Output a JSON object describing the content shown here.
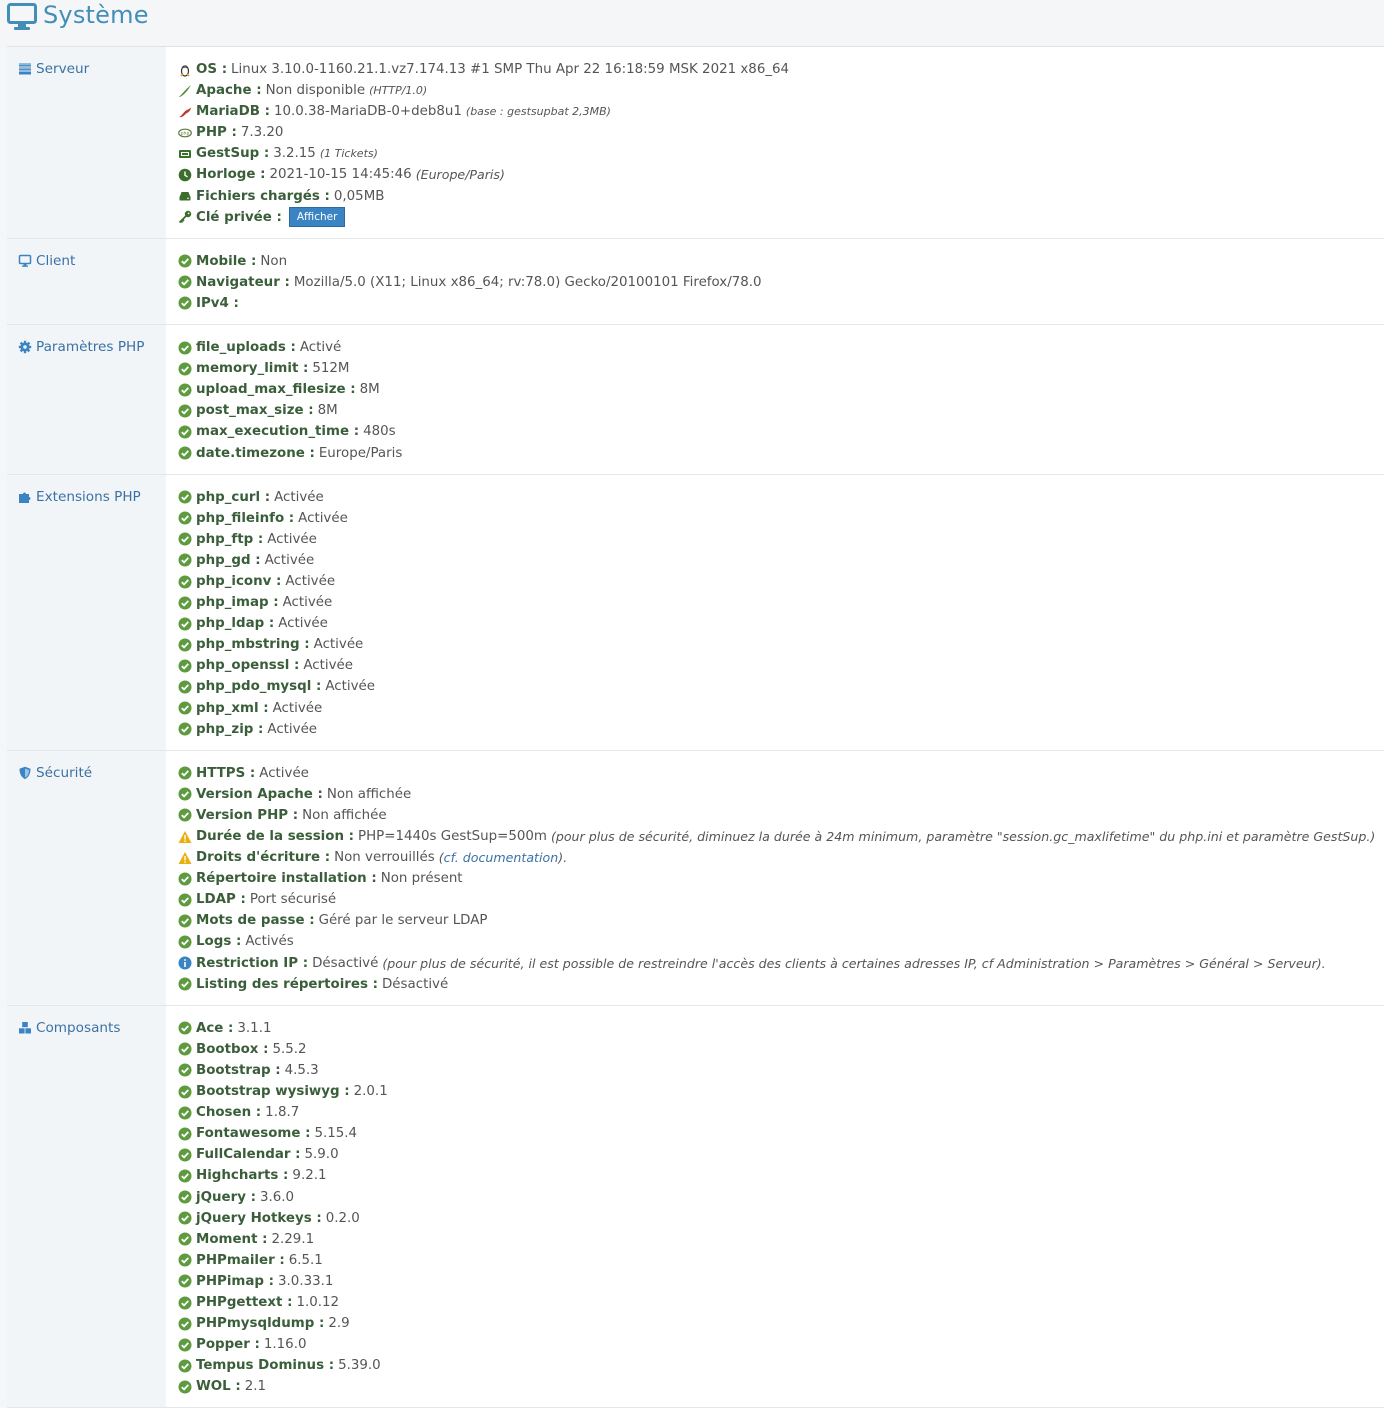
{
  "header": {
    "title": "Système"
  },
  "sections": {
    "serveur": {
      "label": "Serveur",
      "rows": [
        {
          "key": "OS :",
          "value": "Linux 3.10.0-1160.21.1.vz7.174.13 #1 SMP Thu Apr 22 16:18:59 MSK 2021 x86_64",
          "icon": "linux-icon"
        },
        {
          "key": "Apache :",
          "value": "Non disponible",
          "note": "(HTTP/1.0)",
          "icon": "apache-feather-icon"
        },
        {
          "key": "MariaDB :",
          "value": "10.0.38-MariaDB-0+deb8u1",
          "note": "(base : gestsupbat 2,3MB)",
          "icon": "mariadb-seal-icon"
        },
        {
          "key": "PHP :",
          "value": "7.3.20",
          "icon": "php-icon"
        },
        {
          "key": "GestSup :",
          "value": "3.2.15",
          "note": "(1 Tickets)",
          "icon": "ticket-icon"
        },
        {
          "key": "Horloge :",
          "value": "2021-10-15 14:45:46",
          "note": "(Europe/Paris)",
          "icon": "clock-icon"
        },
        {
          "key": "Fichiers chargés :",
          "value": "0,05MB",
          "icon": "hdd-icon"
        },
        {
          "key": "Clé privée :",
          "button": "Afficher",
          "icon": "key-icon"
        }
      ]
    },
    "client": {
      "label": "Client",
      "rows": [
        {
          "key": "Mobile :",
          "value": "Non"
        },
        {
          "key": "Navigateur :",
          "value": "Mozilla/5.0 (X11; Linux x86_64; rv:78.0) Gecko/20100101 Firefox/78.0"
        },
        {
          "key": "IPv4 :",
          "value": ""
        }
      ]
    },
    "php_params": {
      "label": "Paramètres PHP",
      "rows": [
        {
          "key": "file_uploads :",
          "value": "Activé"
        },
        {
          "key": "memory_limit :",
          "value": "512M"
        },
        {
          "key": "upload_max_filesize :",
          "value": "8M"
        },
        {
          "key": "post_max_size :",
          "value": "8M"
        },
        {
          "key": "max_execution_time :",
          "value": "480s"
        },
        {
          "key": "date.timezone :",
          "value": "Europe/Paris"
        }
      ]
    },
    "php_ext": {
      "label": "Extensions PHP",
      "rows": [
        {
          "key": "php_curl :",
          "value": "Activée"
        },
        {
          "key": "php_fileinfo :",
          "value": "Activée"
        },
        {
          "key": "php_ftp :",
          "value": "Activée"
        },
        {
          "key": "php_gd :",
          "value": "Activée"
        },
        {
          "key": "php_iconv :",
          "value": "Activée"
        },
        {
          "key": "php_imap :",
          "value": "Activée"
        },
        {
          "key": "php_ldap :",
          "value": "Activée"
        },
        {
          "key": "php_mbstring :",
          "value": "Activée"
        },
        {
          "key": "php_openssl :",
          "value": "Activée"
        },
        {
          "key": "php_pdo_mysql :",
          "value": "Activée"
        },
        {
          "key": "php_xml :",
          "value": "Activée"
        },
        {
          "key": "php_zip :",
          "value": "Activée"
        }
      ]
    },
    "securite": {
      "label": "Sécurité",
      "rows": [
        {
          "key": "HTTPS :",
          "value": "Activée",
          "status": "ok"
        },
        {
          "key": "Version Apache :",
          "value": "Non affichée",
          "status": "ok"
        },
        {
          "key": "Version PHP :",
          "value": "Non affichée",
          "status": "ok"
        },
        {
          "key": "Durée de la session :",
          "value": "PHP=1440s GestSup=500m",
          "note": "(pour plus de sécurité, diminuez la durée à 24m minimum, paramètre \"session.gc_maxlifetime\" du php.ini et paramètre GestSup.)",
          "status": "warn"
        },
        {
          "key": "Droits d'écriture :",
          "value": "Non verrouillés",
          "note_link": "cf. documentation",
          "status": "warn"
        },
        {
          "key": "Répertoire installation :",
          "value": "Non présent",
          "status": "ok"
        },
        {
          "key": "LDAP :",
          "value": "Port sécurisé",
          "status": "ok"
        },
        {
          "key": "Mots de passe :",
          "value": "Géré par le serveur LDAP",
          "status": "ok"
        },
        {
          "key": "Logs :",
          "value": "Activés",
          "status": "ok"
        },
        {
          "key": "Restriction IP :",
          "value": "Désactivé",
          "note": "(pour plus de sécurité, il est possible de restreindre l'accès des clients à certaines adresses IP, cf Administration > Paramètres > Général > Serveur).",
          "status": "info"
        },
        {
          "key": "Listing des répertoires :",
          "value": "Désactivé",
          "status": "ok"
        }
      ]
    },
    "composants": {
      "label": "Composants",
      "rows": [
        {
          "key": "Ace :",
          "value": "3.1.1"
        },
        {
          "key": "Bootbox :",
          "value": "5.5.2"
        },
        {
          "key": "Bootstrap :",
          "value": "4.5.3"
        },
        {
          "key": "Bootstrap wysiwyg :",
          "value": "2.0.1"
        },
        {
          "key": "Chosen :",
          "value": "1.8.7"
        },
        {
          "key": "Fontawesome :",
          "value": "5.15.4"
        },
        {
          "key": "FullCalendar :",
          "value": "5.9.0"
        },
        {
          "key": "Highcharts :",
          "value": "9.2.1"
        },
        {
          "key": "jQuery :",
          "value": "3.6.0"
        },
        {
          "key": "jQuery Hotkeys :",
          "value": "0.2.0"
        },
        {
          "key": "Moment :",
          "value": "2.29.1"
        },
        {
          "key": "PHPmailer :",
          "value": "6.5.1"
        },
        {
          "key": "PHPimap :",
          "value": "3.0.33.1"
        },
        {
          "key": "PHPgettext :",
          "value": "1.0.12"
        },
        {
          "key": "PHPmysqldump :",
          "value": "2.9"
        },
        {
          "key": "Popper :",
          "value": "1.16.0"
        },
        {
          "key": "Tempus Dominus :",
          "value": "5.39.0"
        },
        {
          "key": "WOL :",
          "value": "2.1"
        }
      ]
    }
  },
  "colors": {
    "accent": "#438eb9",
    "ok": "#5d9b3e",
    "warn": "#e8b10e",
    "info": "#3a84c4"
  }
}
